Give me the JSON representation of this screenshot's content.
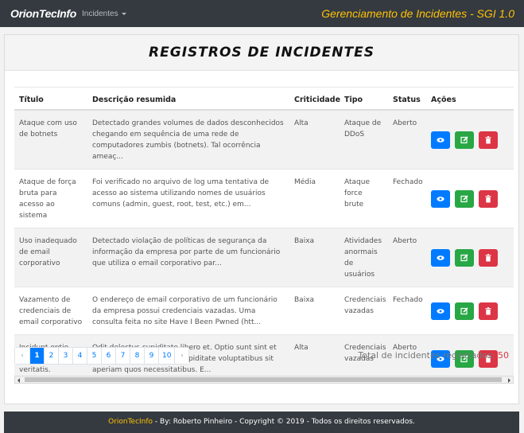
{
  "navbar": {
    "brand": "OrionTecInfo",
    "menu_label": "Incidentes",
    "system_title": "Gerenciamento de Incidentes - SGI 1.0"
  },
  "page": {
    "heading": "REGISTROS DE INCIDENTES"
  },
  "table": {
    "columns": [
      "Título",
      "Descrição resumida",
      "Criticidade",
      "Tipo",
      "Status",
      "Ações"
    ],
    "rows": [
      {
        "titulo": "Ataque com uso de botnets",
        "descricao": "Detectado grandes volumes de dados desconhecidos chegando em sequência de uma rede de computadores zumbis (botnets). Tal ocorrência ameaç...",
        "criticidade": "Alta",
        "tipo": "Ataque de DDoS",
        "status": "Aberto"
      },
      {
        "titulo": "Ataque de força bruta para acesso ao sistema",
        "descricao": "Foi verificado no arquivo de log uma tentativa de acesso ao sistema utilizando nomes de usuários comuns (admin, guest, root, test, etc.) em...",
        "criticidade": "Média",
        "tipo": "Ataque force brute",
        "status": "Fechado"
      },
      {
        "titulo": "Uso inadequado de email corporativo",
        "descricao": "Detectado violação de políticas de segurança da informação da empresa por parte de um funcionário que utiliza o email corporativo par...",
        "criticidade": "Baixa",
        "tipo": "Atividades anormais de usuários",
        "status": "Aberto"
      },
      {
        "titulo": "Vazamento de credenciais de email corporativo",
        "descricao": "O endereço de email corporativo de um funcionário da empresa possui credenciais vazadas. Uma consulta feita no site Have I Been Pwned (htt...",
        "criticidade": "Baixa",
        "tipo": "Credenciais vazadas",
        "status": "Fechado"
      },
      {
        "titulo": "Incidunt optio eos nihil veritatis.",
        "descricao": "Odit delectus cupiditate libero et. Optio sunt sint et qui. Hic deleniti repellat cupiditate voluptatibus sit aperiam quos necessitatibus. E...",
        "criticidade": "Alta",
        "tipo": "Credenciais vazadas",
        "status": "Aberto"
      }
    ]
  },
  "pagination": {
    "prev": "‹",
    "pages": [
      "1",
      "2",
      "3",
      "4",
      "5",
      "6",
      "7",
      "8",
      "9",
      "10"
    ],
    "active": "1",
    "next": "›"
  },
  "summary": {
    "total_label": "Total de incidentes registrados:",
    "total_count": "50"
  },
  "footer": {
    "brand": "OrionTecInfo",
    "text": " - By: Roberto Pinheiro - Copyright © 2019 - Todos os direitos reservados."
  },
  "icons": {
    "view": "eye-icon",
    "edit": "edit-icon",
    "delete": "trash-icon"
  },
  "colors": {
    "navbar_bg": "#343a40",
    "system_title": "#ffc107",
    "primary": "#007bff",
    "success": "#28a745",
    "danger": "#dc3545"
  }
}
